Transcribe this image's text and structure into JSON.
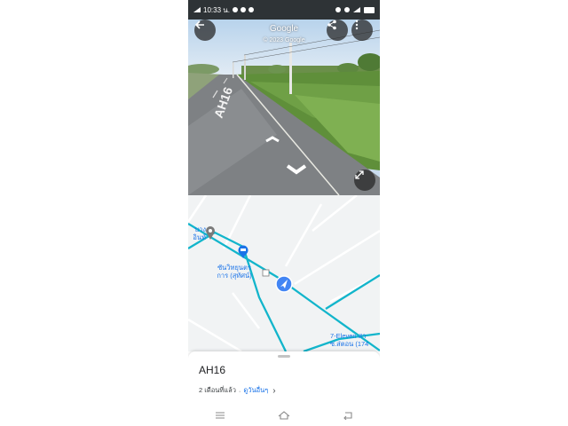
{
  "status_bar": {
    "time_label": "10:33 น.",
    "battery_label": "100"
  },
  "street_view": {
    "title": "Google",
    "copyright": "© 2023 Google",
    "road_marking": "AH16",
    "icons": [
      "arrow-back-icon",
      "share-icon",
      "more-vert-icon",
      "expand-icon"
    ]
  },
  "map": {
    "labels": {
      "place_1": "บาง\nอินท์",
      "dealer": "ซันวิทยุนตร\nการ (สุทัศน์)",
      "seven_eleven": "7-Eleven สา\nซ.ส่ตอน (174"
    },
    "colors": {
      "road": "#12b5cb",
      "location_marker": "#4285f4"
    }
  },
  "sheet": {
    "road_name": "AH16",
    "date_label": "2 เดือนที่แล้ว",
    "separator": "·",
    "more_link": "ดูวันอื่นๆ"
  },
  "nav_bar": {
    "icons": [
      "recents-icon",
      "home-icon",
      "back-icon"
    ]
  }
}
